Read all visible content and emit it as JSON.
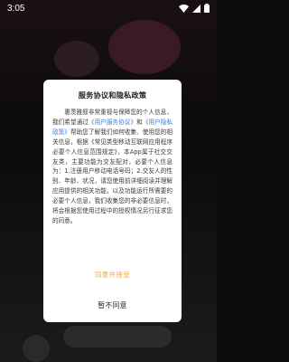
{
  "status_bar": {
    "time": "3:05",
    "icons": [
      "wifi-icon",
      "signal-icon",
      "battery-icon"
    ]
  },
  "dialog": {
    "title": "服务协议和隐私政策",
    "body_part1": "惠羡雅叙非常重视与保障您的个人信息，我们希望通过",
    "link_service": "《用户服务协议》",
    "and": "和",
    "link_privacy": "《用户隐私政策》",
    "body_part2": "帮助您了解我们如何收集、使用您的相关信息，根据《常见类型移动互联网应用程序必要个人信息范围规定》，本App属于社交交友类，主要功能为交友配对，必要个人信息为：1.注册用户移动电话号码；2.交友人的性别、年龄、状况，请您使用前详细阅读并理解应用提供的相关功能，以及功能运行所需要的必要个人信息，我们收集您的非必要信息时，将会根据您使用过程中的授权情况另行征求您的同意。",
    "agree_label": "同意并接受",
    "disagree_label": "暂不同意"
  },
  "colors": {
    "link": "#3b7dd8",
    "agree": "#f3a83a",
    "dialog_bg": "#ffffff",
    "overlay": "#0d0d0d"
  }
}
